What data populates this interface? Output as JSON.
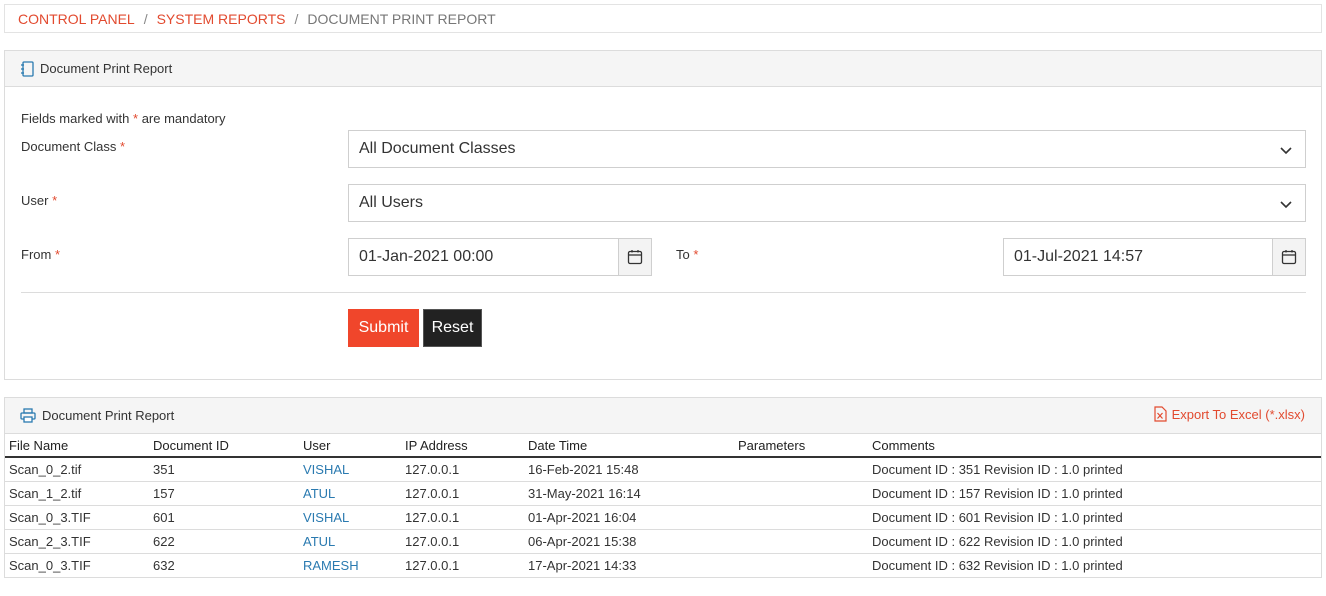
{
  "breadcrumb": {
    "items": [
      "CONTROL PANEL",
      "SYSTEM REPORTS",
      "DOCUMENT PRINT REPORT"
    ],
    "separator": "/"
  },
  "form_panel": {
    "title": "Document Print Report",
    "mandatory_note_prefix": "Fields marked with",
    "mandatory_star": "*",
    "mandatory_note_suffix": "are mandatory",
    "document_class": {
      "label": "Document Class",
      "value": "All Document Classes"
    },
    "user": {
      "label": "User",
      "value": "All Users"
    },
    "from": {
      "label": "From",
      "value": "01-Jan-2021 00:00"
    },
    "to": {
      "label": "To",
      "value": "01-Jul-2021 14:57"
    },
    "submit_label": "Submit",
    "reset_label": "Reset"
  },
  "report_panel": {
    "title": "Document Print Report",
    "export_label": "Export To Excel (*.xlsx)",
    "columns": [
      "File Name",
      "Document ID",
      "User",
      "IP Address",
      "Date Time",
      "Parameters",
      "Comments"
    ],
    "rows": [
      [
        "Scan_0_2.tif",
        "351",
        "VISHAL",
        "127.0.0.1",
        "16-Feb-2021 15:48",
        "",
        "Document ID : 351 Revision ID : 1.0 printed"
      ],
      [
        "Scan_1_2.tif",
        "157",
        "ATUL",
        "127.0.0.1",
        "31-May-2021 16:14",
        "",
        "Document ID : 157 Revision ID : 1.0 printed"
      ],
      [
        "Scan_0_3.TIF",
        "601",
        "VISHAL",
        "127.0.0.1",
        "01-Apr-2021 16:04",
        "",
        "Document ID : 601 Revision ID : 1.0 printed"
      ],
      [
        "Scan_2_3.TIF",
        "622",
        "ATUL",
        "127.0.0.1",
        "06-Apr-2021 15:38",
        "",
        "Document ID : 622 Revision ID : 1.0 printed"
      ],
      [
        "Scan_0_3.TIF",
        "632",
        "RAMESH",
        "127.0.0.1",
        "17-Apr-2021 14:33",
        "",
        "Document ID : 632 Revision ID : 1.0 printed"
      ]
    ]
  },
  "colors": {
    "accent": "#f0462b",
    "link": "#2a7ab0",
    "dark_button": "#222222"
  }
}
